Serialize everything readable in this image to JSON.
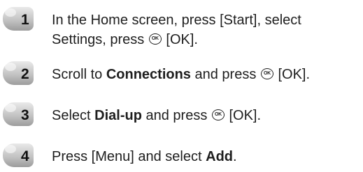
{
  "steps": [
    {
      "number": "1",
      "line1_prefix": "In the Home screen, press [Start], select",
      "line2_prefix": "Settings, press",
      "line2_suffix": "[OK]."
    },
    {
      "number": "2",
      "prefix": "Scroll to",
      "bold": "Connections",
      "middle": "and press",
      "suffix": "[OK]."
    },
    {
      "number": "3",
      "prefix": "Select",
      "bold": "Dial-up",
      "middle": "and press",
      "suffix": "[OK]."
    },
    {
      "number": "4",
      "prefix": "Press [Menu] and select",
      "bold": "Add",
      "suffix": "."
    }
  ],
  "icons": {
    "ok_key": "ok-key-icon",
    "step_badge": "step-badge-icon"
  }
}
